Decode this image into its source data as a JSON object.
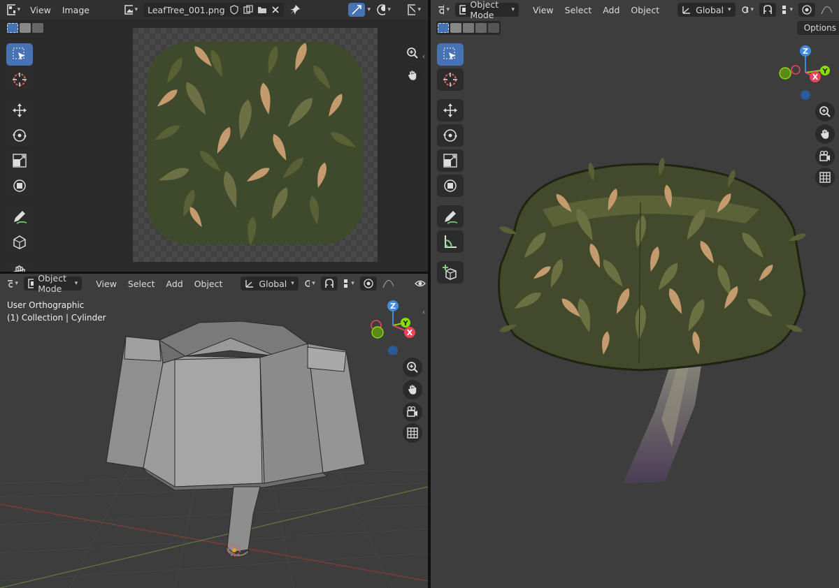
{
  "image_editor": {
    "menus": [
      "View",
      "Image"
    ],
    "image_name": "LeafTree_001.png"
  },
  "viewport_bottom": {
    "mode": "Object Mode",
    "menus": [
      "View",
      "Select",
      "Add",
      "Object"
    ],
    "transform_orientation": "Global",
    "view_name": "User Orthographic",
    "collection_info": "(1) Collection | Cylinder"
  },
  "viewport_right": {
    "mode": "Object Mode",
    "menus": [
      "View",
      "Select",
      "Add",
      "Object"
    ],
    "transform_orientation": "Global",
    "options_label": "Options"
  },
  "gizmo": {
    "x": "X",
    "y": "Y",
    "z": "Z"
  },
  "icons": [
    "cursor-icon",
    "move-icon",
    "rotate-icon",
    "scale-icon",
    "transform-icon",
    "annotate-icon",
    "add-cube-icon",
    "hand-icon",
    "measure-icon",
    "zoom-icon",
    "camera-icon",
    "grid-icon",
    "pin-icon",
    "close-icon",
    "folder-icon",
    "shield-icon"
  ],
  "colors": {
    "accent": "#4772b3",
    "header": "#303030",
    "viewport_bg": "#3d3d3d",
    "axis_x": "#e8445a",
    "axis_y": "#8bdc00",
    "axis_z": "#3f8bdf",
    "leaf_dark": "#5a5a34",
    "leaf_light": "#c39b6e"
  }
}
